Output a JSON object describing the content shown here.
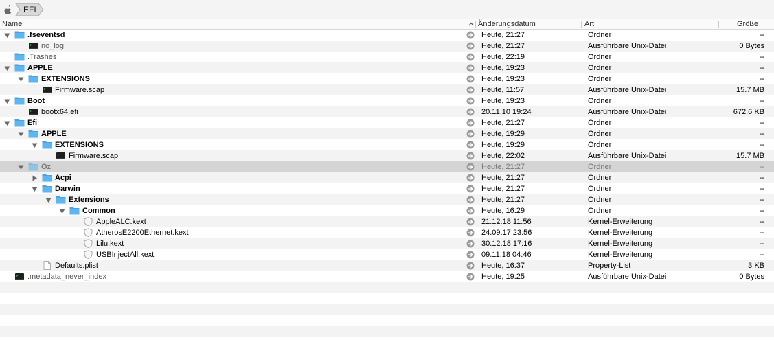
{
  "pathbar": {
    "current": "EFI"
  },
  "columns": {
    "name": "Name",
    "date": "Änderungsdatum",
    "kind": "Art",
    "size": "Größe"
  },
  "rows": [
    {
      "name": ".fseventsd",
      "icon": "folder-icon",
      "depth": 0,
      "disclosure": "open",
      "bold": true,
      "date": "Heute, 21:27",
      "kind": "Ordner",
      "size": "--"
    },
    {
      "name": "no_log",
      "icon": "terminal-exec-icon",
      "depth": 1,
      "disclosure": "none",
      "bold": false,
      "dim": true,
      "date": "Heute, 21:27",
      "kind": "Ausführbare Unix-Datei",
      "size": "0 Bytes"
    },
    {
      "name": ".Trashes",
      "icon": "folder-icon",
      "depth": 0,
      "disclosure": "none",
      "bold": false,
      "dim": true,
      "date": "Heute, 22:19",
      "kind": "Ordner",
      "size": "--"
    },
    {
      "name": "APPLE",
      "icon": "folder-icon",
      "depth": 0,
      "disclosure": "open",
      "bold": true,
      "date": "Heute, 19:23",
      "kind": "Ordner",
      "size": "--"
    },
    {
      "name": "EXTENSIONS",
      "icon": "folder-icon",
      "depth": 1,
      "disclosure": "open",
      "bold": true,
      "date": "Heute, 19:23",
      "kind": "Ordner",
      "size": "--"
    },
    {
      "name": "Firmware.scap",
      "icon": "terminal-exec-icon",
      "depth": 2,
      "disclosure": "none",
      "bold": false,
      "date": "Heute, 11:57",
      "kind": "Ausführbare Unix-Datei",
      "size": "15.7 MB"
    },
    {
      "name": "Boot",
      "icon": "folder-icon",
      "depth": 0,
      "disclosure": "open",
      "bold": true,
      "date": "Heute, 19:23",
      "kind": "Ordner",
      "size": "--"
    },
    {
      "name": "bootx64.efi",
      "icon": "terminal-exec-icon",
      "depth": 1,
      "disclosure": "none",
      "bold": false,
      "date": "20.11.10 19:24",
      "kind": "Ausführbare Unix-Datei",
      "size": "672.6 KB"
    },
    {
      "name": "Efi",
      "icon": "folder-icon",
      "depth": 0,
      "disclosure": "open",
      "bold": true,
      "date": "Heute, 21:27",
      "kind": "Ordner",
      "size": "--"
    },
    {
      "name": "APPLE",
      "icon": "folder-icon",
      "depth": 1,
      "disclosure": "open",
      "bold": true,
      "date": "Heute, 19:29",
      "kind": "Ordner",
      "size": "--"
    },
    {
      "name": "EXTENSIONS",
      "icon": "folder-icon",
      "depth": 2,
      "disclosure": "open",
      "bold": true,
      "date": "Heute, 19:29",
      "kind": "Ordner",
      "size": "--"
    },
    {
      "name": "Firmware.scap",
      "icon": "terminal-exec-icon",
      "depth": 3,
      "disclosure": "none",
      "bold": false,
      "date": "Heute, 22:02",
      "kind": "Ausführbare Unix-Datei",
      "size": "15.7 MB"
    },
    {
      "name": "Oz",
      "icon": "folder-icon",
      "depth": 1,
      "disclosure": "open",
      "bold": true,
      "selected": true,
      "date": "Heute, 21:27",
      "kind": "Ordner",
      "size": "--"
    },
    {
      "name": "Acpi",
      "icon": "folder-icon",
      "depth": 2,
      "disclosure": "closed",
      "bold": true,
      "date": "Heute, 21:27",
      "kind": "Ordner",
      "size": "--"
    },
    {
      "name": "Darwin",
      "icon": "folder-icon",
      "depth": 2,
      "disclosure": "open",
      "bold": true,
      "date": "Heute, 21:27",
      "kind": "Ordner",
      "size": "--"
    },
    {
      "name": "Extensions",
      "icon": "folder-icon",
      "depth": 3,
      "disclosure": "open",
      "bold": true,
      "date": "Heute, 21:27",
      "kind": "Ordner",
      "size": "--"
    },
    {
      "name": "Common",
      "icon": "folder-icon",
      "depth": 4,
      "disclosure": "open",
      "bold": true,
      "date": "Heute, 16:29",
      "kind": "Ordner",
      "size": "--"
    },
    {
      "name": "AppleALC.kext",
      "icon": "kext-shield-icon",
      "depth": 5,
      "disclosure": "none",
      "bold": false,
      "date": "21.12.18 11:56",
      "kind": "Kernel-Erweiterung",
      "size": "--"
    },
    {
      "name": "AtherosE2200Ethernet.kext",
      "icon": "kext-shield-icon",
      "depth": 5,
      "disclosure": "none",
      "bold": false,
      "date": "24.09.17 23:56",
      "kind": "Kernel-Erweiterung",
      "size": "--"
    },
    {
      "name": "Lilu.kext",
      "icon": "kext-shield-icon",
      "depth": 5,
      "disclosure": "none",
      "bold": false,
      "date": "30.12.18 17:16",
      "kind": "Kernel-Erweiterung",
      "size": "--"
    },
    {
      "name": "USBInjectAll.kext",
      "icon": "kext-shield-icon",
      "depth": 5,
      "disclosure": "none",
      "bold": false,
      "date": "09.11.18 04:46",
      "kind": "Kernel-Erweiterung",
      "size": "--"
    },
    {
      "name": "Defaults.plist",
      "icon": "document-icon",
      "depth": 2,
      "disclosure": "none",
      "bold": false,
      "date": "Heute, 16:37",
      "kind": "Property-List",
      "size": "3 KB"
    },
    {
      "name": ".metadata_never_index",
      "icon": "terminal-exec-icon",
      "depth": 0,
      "disclosure": "none",
      "bold": false,
      "dim": true,
      "date": "Heute, 19:25",
      "kind": "Ausführbare Unix-Datei",
      "size": "0 Bytes"
    }
  ],
  "colors": {
    "folder": "#5eb6f0",
    "folder_tab": "#4aa3e0",
    "stripe": "#f3f3f3",
    "selection": "#d4d4d4",
    "goto_arrow": "#9a9a9a"
  }
}
